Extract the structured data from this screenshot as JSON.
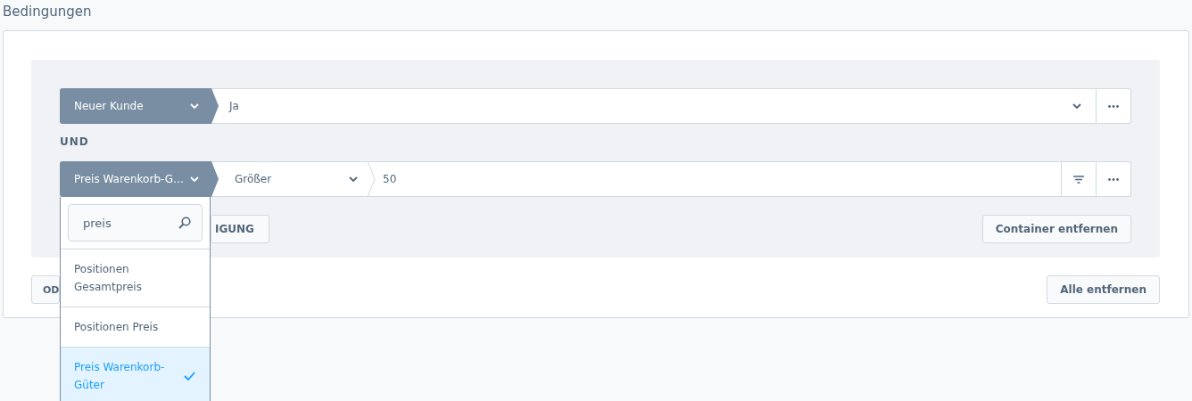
{
  "title": "Bedingungen",
  "conditions": [
    {
      "kind": "select",
      "field": "Neuer Kunde",
      "value": "Ja"
    },
    {
      "kind": "filter",
      "field": "Preis Warenkorb-G…",
      "operator": "Größer",
      "value": "50"
    }
  ],
  "connector": "UND",
  "container_buttons": [
    {
      "label": "IGUNG"
    },
    {
      "label": "Container entfernen"
    }
  ],
  "outer_buttons": [
    {
      "label": "OD"
    },
    {
      "label": "Alle entfernen"
    }
  ],
  "dropdown": {
    "search": "preis",
    "options": [
      {
        "label": "Positionen Gesamtpreis",
        "selected": false
      },
      {
        "label": "Positionen Preis",
        "selected": false
      },
      {
        "label": "Preis Warenkorb-Güter",
        "selected": true
      }
    ]
  }
}
